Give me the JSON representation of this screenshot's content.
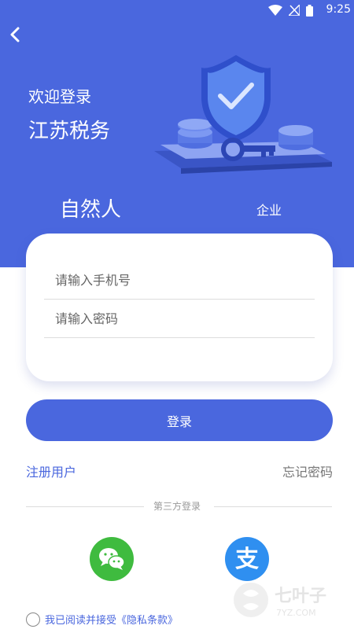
{
  "status_bar": {
    "time": "9:25"
  },
  "header": {
    "welcome": "欢迎登录",
    "brand": "江苏税务"
  },
  "tabs": {
    "natural_person": "自然人",
    "enterprise": "企业"
  },
  "form": {
    "phone_placeholder": "请输入手机号",
    "password_placeholder": "请输入密码",
    "login_label": "登录"
  },
  "links": {
    "register": "注册用户",
    "forgot": "忘记密码"
  },
  "third_party": {
    "label": "第三方登录",
    "wechat_icon": "wechat-icon",
    "alipay_icon": "alipay-icon"
  },
  "agreement": {
    "text": "我已阅读并接受《隐私条款》"
  },
  "watermark": {
    "brand": "七叶子",
    "domain": "7YZ.COM"
  },
  "colors": {
    "primary": "#4a67de",
    "wechat": "#3fbb3f",
    "alipay": "#2f8ff0"
  }
}
